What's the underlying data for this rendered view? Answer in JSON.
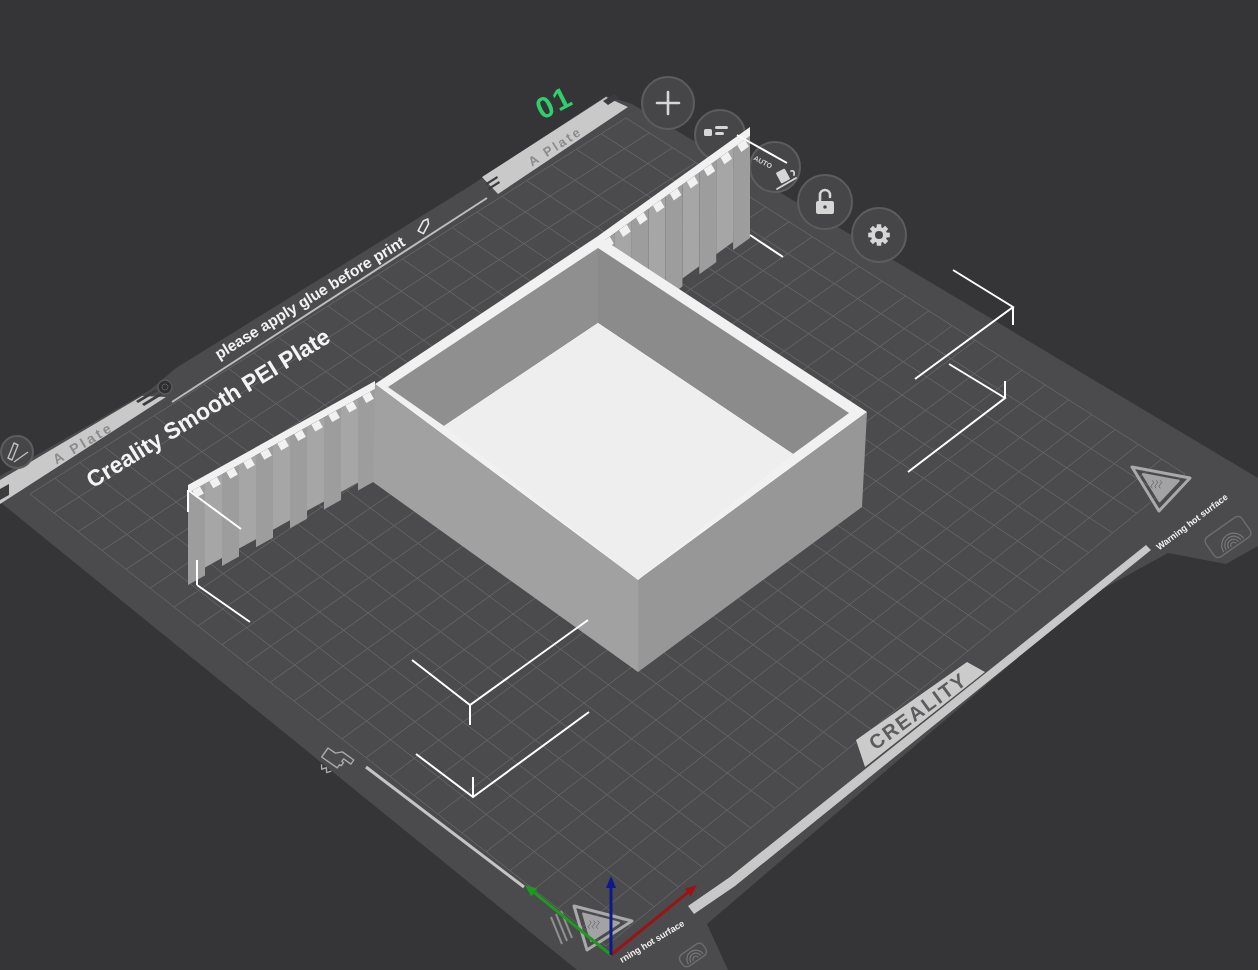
{
  "plate": {
    "number": "01",
    "tabs": [
      {
        "label": "A Plate"
      },
      {
        "label": "A Plate"
      }
    ],
    "hint": "please apply glue before print",
    "plate_type": "Creality Smooth PEI Plate",
    "warnings": [
      {
        "text": "Warning hot surface"
      },
      {
        "text": "rning hot surface"
      }
    ],
    "brand": "CREALITY"
  },
  "plate_toolbar": [
    {
      "kind": "add"
    },
    {
      "kind": "arrange"
    },
    {
      "kind": "auto",
      "label": "AUTO"
    },
    {
      "kind": "lock"
    },
    {
      "kind": "settings"
    }
  ]
}
